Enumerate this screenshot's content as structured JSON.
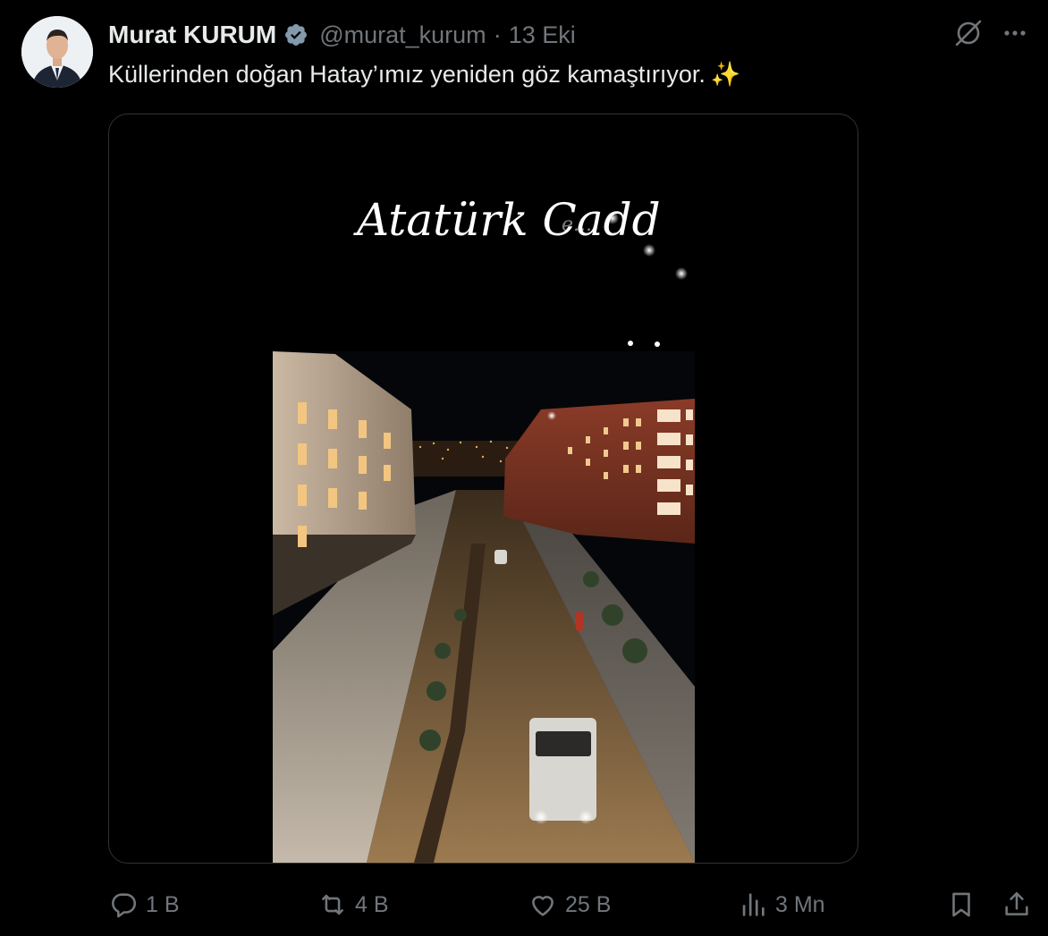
{
  "tweet": {
    "author_name": "Murat KURUM",
    "handle": "@murat_kurum",
    "separator": "·",
    "date": "13 Eki",
    "text": "Küllerinden doğan Hatay’ımız yeniden göz kamaştırıyor.",
    "emoji": "✨"
  },
  "media": {
    "overlay_script_text": "Atatürk Cadd",
    "overlay_fading_text": "e..."
  },
  "actions": {
    "reply_count": "1 B",
    "repost_count": "4 B",
    "like_count": "25 B",
    "view_count": "3 Mn"
  },
  "colors": {
    "background": "#000000",
    "text_primary": "#e7e9ea",
    "text_secondary": "#71767b",
    "border": "#2f3336",
    "verified_badge": "#829aab"
  },
  "icons": {
    "verified": "verified-badge-icon",
    "grok": "grok-icon",
    "more": "more-icon",
    "reply": "reply-icon",
    "repost": "repost-icon",
    "like": "like-icon",
    "views": "views-icon",
    "bookmark": "bookmark-icon",
    "share": "share-icon"
  }
}
